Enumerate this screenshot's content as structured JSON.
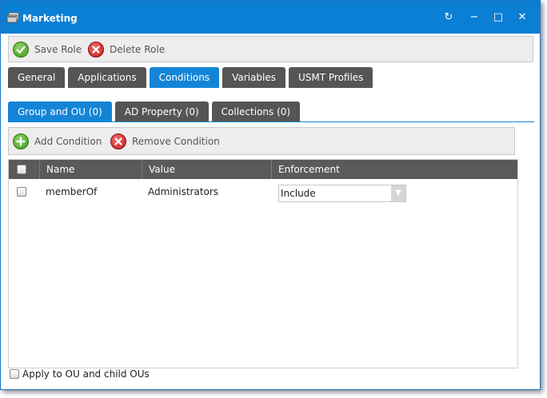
{
  "window": {
    "title": "Marketing",
    "title_icon": "app-window-icon",
    "accent": "#0b7fd4"
  },
  "window_controls": {
    "refresh": "↻",
    "minimize": "−",
    "maximize": "□",
    "close": "✕"
  },
  "toolbar": {
    "save_label": "Save Role",
    "delete_label": "Delete Role"
  },
  "tabs": [
    {
      "label": "General",
      "active": false
    },
    {
      "label": "Applications",
      "active": false
    },
    {
      "label": "Conditions",
      "active": true
    },
    {
      "label": "Variables",
      "active": false
    },
    {
      "label": "USMT Profiles",
      "active": false
    }
  ],
  "subtabs": [
    {
      "label": "Group and OU (0)",
      "active": true
    },
    {
      "label": "AD Property (0)",
      "active": false
    },
    {
      "label": "Collections (0)",
      "active": false
    }
  ],
  "conditions_toolbar": {
    "add_label": "Add Condition",
    "remove_label": "Remove Condition"
  },
  "grid": {
    "columns": [
      "Name",
      "Value",
      "Enforcement"
    ],
    "rows": [
      {
        "name": "memberOf",
        "value": "Administrators",
        "enforcement": "Include"
      }
    ]
  },
  "footer": {
    "apply_label": "Apply to OU and child OUs",
    "apply_checked": false
  }
}
